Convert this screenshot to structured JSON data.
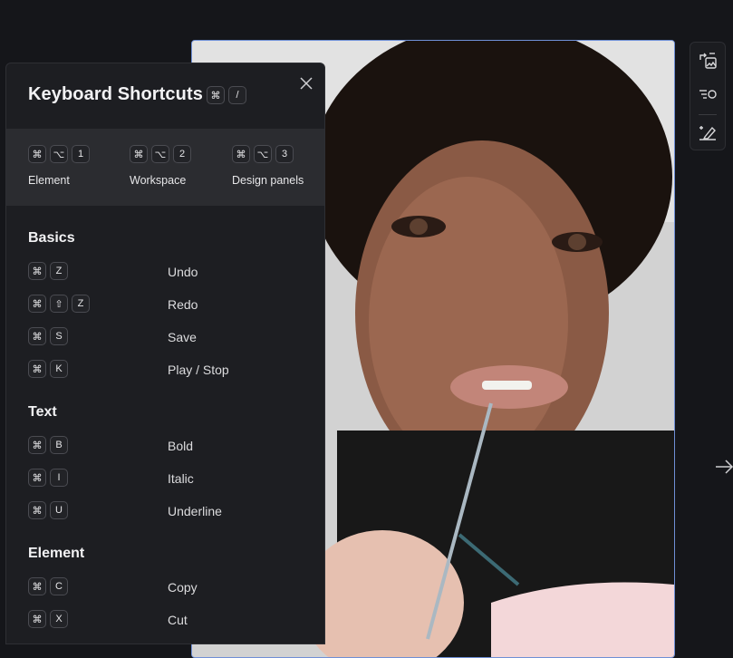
{
  "panel": {
    "title": "Keyboard Shortcuts",
    "title_keys": [
      "⌘",
      "/"
    ],
    "close_icon": "close-icon"
  },
  "quick": [
    {
      "keys": [
        "⌘",
        "⌥",
        "1"
      ],
      "label": "Element"
    },
    {
      "keys": [
        "⌘",
        "⌥",
        "2"
      ],
      "label": "Workspace"
    },
    {
      "keys": [
        "⌘",
        "⌥",
        "3"
      ],
      "label": "Design panels"
    }
  ],
  "sections": [
    {
      "title": "Basics",
      "rows": [
        {
          "keys": [
            "⌘",
            "Z"
          ],
          "label": "Undo"
        },
        {
          "keys": [
            "⌘",
            "⇧",
            "Z"
          ],
          "label": "Redo"
        },
        {
          "keys": [
            "⌘",
            "S"
          ],
          "label": "Save"
        },
        {
          "keys": [
            "⌘",
            "K"
          ],
          "label": "Play / Stop"
        }
      ]
    },
    {
      "title": "Text",
      "rows": [
        {
          "keys": [
            "⌘",
            "B"
          ],
          "label": "Bold"
        },
        {
          "keys": [
            "⌘",
            "I"
          ],
          "label": "Italic"
        },
        {
          "keys": [
            "⌘",
            "U"
          ],
          "label": "Underline"
        }
      ]
    },
    {
      "title": "Element",
      "rows": [
        {
          "keys": [
            "⌘",
            "C"
          ],
          "label": "Copy"
        },
        {
          "keys": [
            "⌘",
            "X"
          ],
          "label": "Cut"
        }
      ]
    }
  ],
  "toolbar": {
    "items": [
      "replace-image-icon",
      "align-adjust-icon",
      "magic-erase-icon"
    ]
  },
  "colors": {
    "background": "#15161a",
    "panel": "#1d1e22",
    "quick_bar": "#2b2c30",
    "selection": "#6f8fd6"
  }
}
